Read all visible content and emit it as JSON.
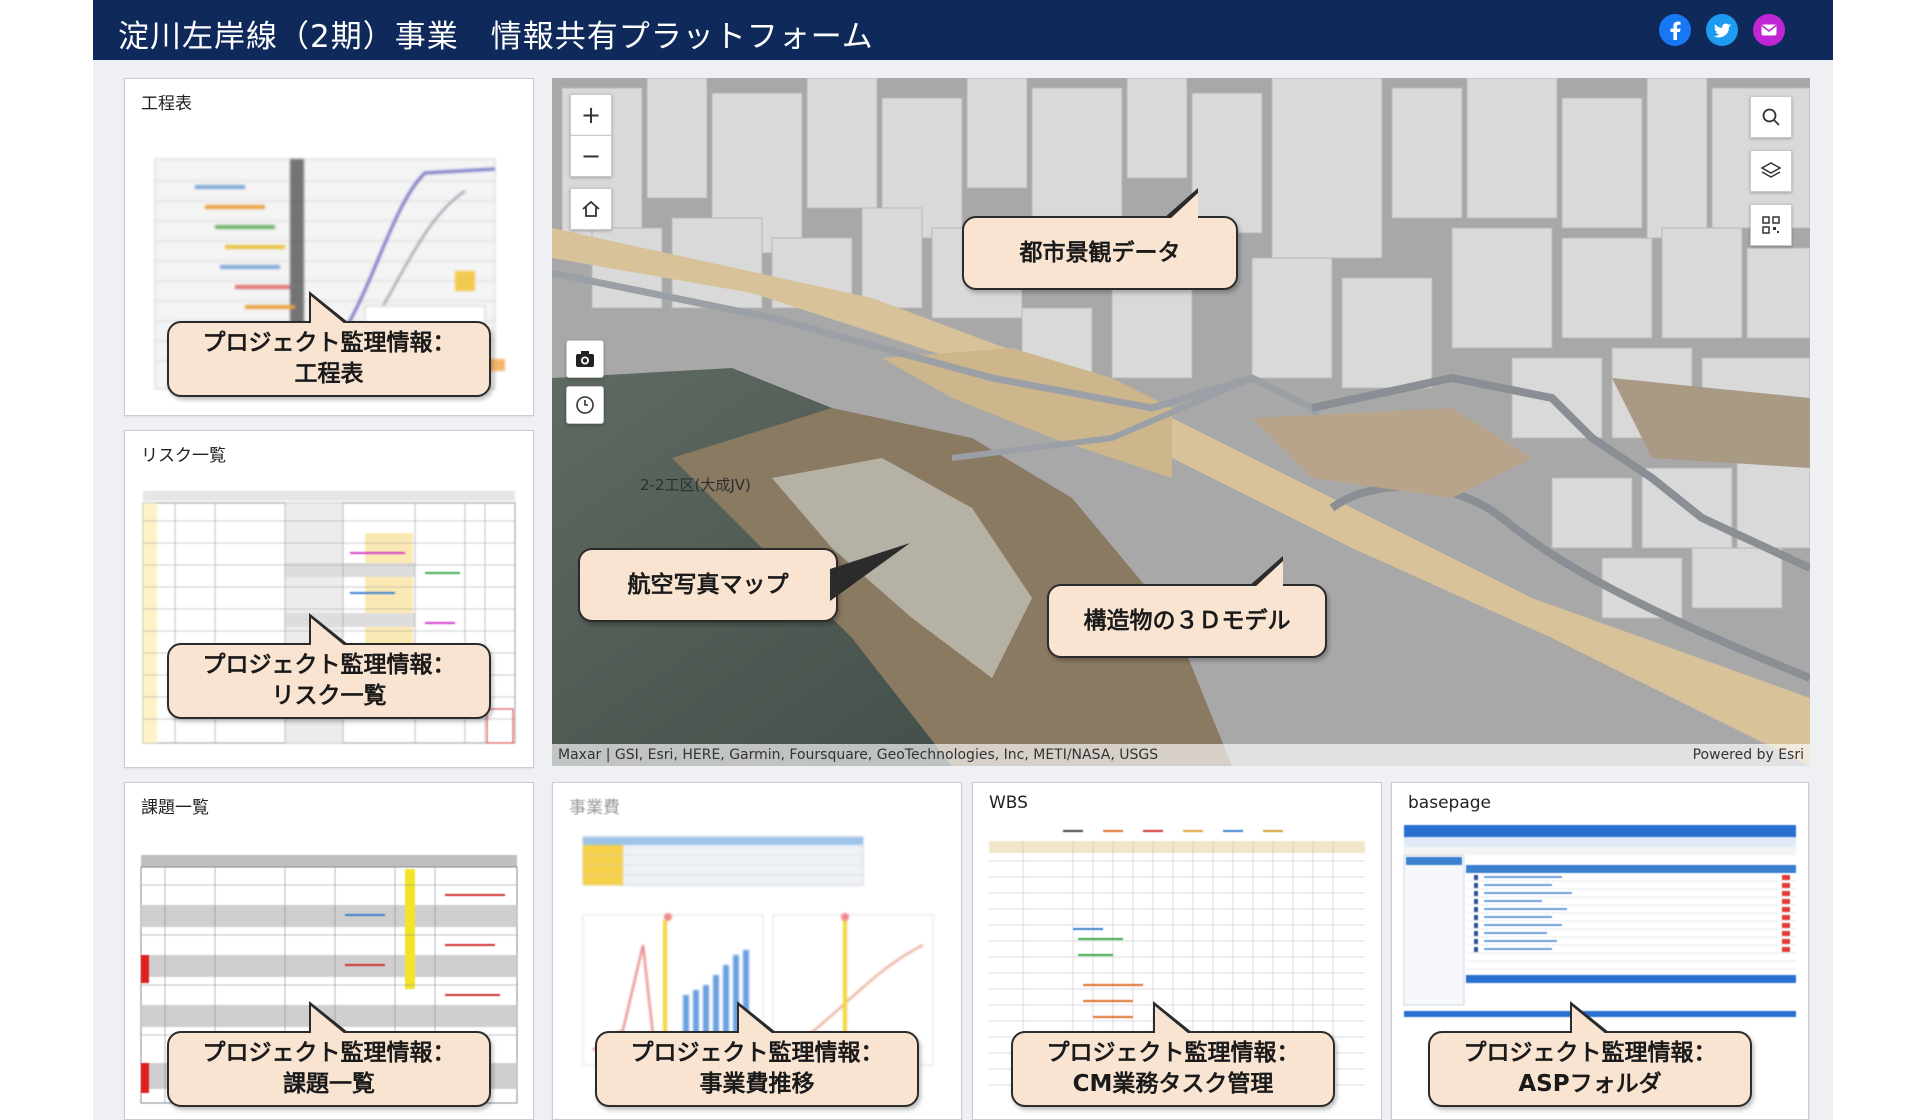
{
  "app": {
    "title": "淀川左岸線（2期）事業　情報共有プラットフォーム",
    "social": [
      {
        "name": "facebook-icon",
        "color": "#1877f2"
      },
      {
        "name": "twitter-icon",
        "color": "#1d9bf0"
      },
      {
        "name": "email-icon",
        "color": "#c026d3"
      }
    ]
  },
  "panels": {
    "schedule": {
      "title": "工程表",
      "callout": [
        "プロジェクト監理情報：",
        "工程表"
      ]
    },
    "risk": {
      "title": "リスク一覧",
      "callout": [
        "プロジェクト監理情報：",
        "リスク一覧"
      ]
    },
    "issues": {
      "title": "課題一覧",
      "callout": [
        "プロジェクト監理情報：",
        "課題一覧"
      ]
    },
    "cost": {
      "title": "事業費",
      "callout": [
        "プロジェクト監理情報：",
        "事業費推移"
      ]
    },
    "wbs": {
      "title": "WBS",
      "callout": [
        "プロジェクト監理情報：",
        "CM業務タスク管理"
      ]
    },
    "basepage": {
      "title": "basepage",
      "callout": [
        "プロジェクト監理情報：",
        "ASPフォルダ"
      ]
    }
  },
  "map": {
    "callouts": {
      "city": "都市景観データ",
      "aerial": "航空写真マップ",
      "structure": "構造物の３Ｄモデル"
    },
    "area_label": "2-2工区(大成JV)",
    "attribution": "Maxar | GSI, Esri, HERE, Garmin, Foursquare, GeoTechnologies, Inc, METI/NASA, USGS",
    "powered_by": "Powered by Esri",
    "controls": {
      "zoom_in": "+",
      "zoom_out": "−"
    }
  }
}
